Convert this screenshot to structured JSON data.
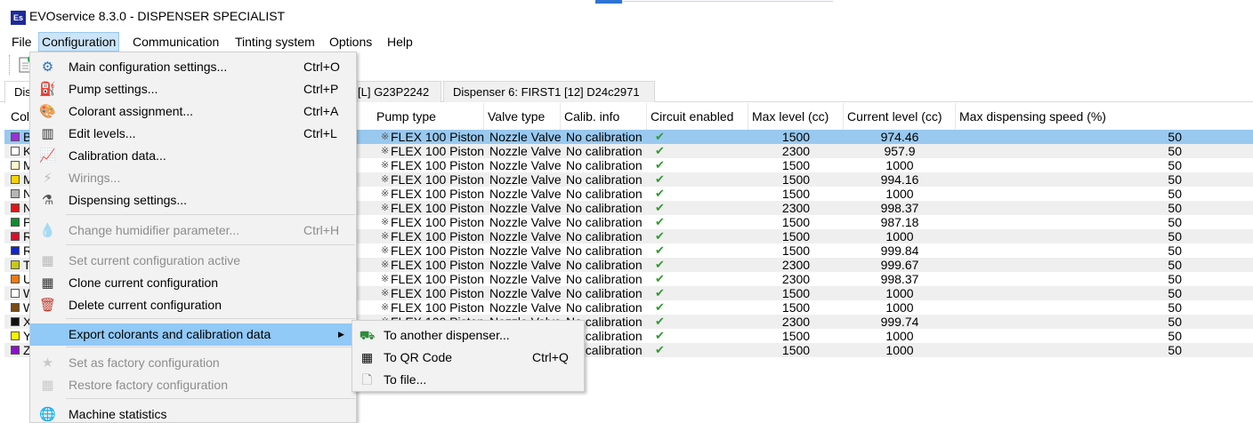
{
  "window": {
    "icon_text": "Es",
    "title": "EVOservice 8.3.0 - DISPENSER SPECIALIST"
  },
  "menubar": [
    "File",
    "Configuration",
    "Communication",
    "Tinting system",
    "Options",
    "Help"
  ],
  "tabs": [
    {
      "label": "Dis"
    },
    {
      "label": "[L] G23P2242"
    },
    {
      "label": "Dispenser 6: FIRST1 [12] D24c2971"
    }
  ],
  "columns": [
    "Colo",
    "Pump type",
    "Valve type",
    "Calib. info",
    "Circuit enabled",
    "Max level (cc)",
    "Current level (cc)",
    "Max dispensing speed (%)"
  ],
  "rows": [
    {
      "color": "#9b30d9",
      "name": "BX",
      "pump": "FLEX 100 Piston",
      "valve": "Nozzle Valve",
      "calib": "No calibration",
      "max": "1500",
      "current": "974.46",
      "speed": "50"
    },
    {
      "color": "#ffffff",
      "name": "KX",
      "pump": "FLEX 100 Piston",
      "valve": "Nozzle Valve",
      "calib": "No calibration",
      "max": "2300",
      "current": "957.9",
      "speed": "50"
    },
    {
      "color": "#fff7cc",
      "name": "MX",
      "pump": "FLEX 100 Piston",
      "valve": "Nozzle Valve",
      "calib": "No calibration",
      "max": "1500",
      "current": "1000",
      "speed": "50"
    },
    {
      "color": "#f5d400",
      "name": "MX",
      "pump": "FLEX 100 Piston",
      "valve": "Nozzle Valve",
      "calib": "No calibration",
      "max": "1500",
      "current": "994.16",
      "speed": "50"
    },
    {
      "color": "#b5b5b5",
      "name": "NX",
      "pump": "FLEX 100 Piston",
      "valve": "Nozzle Valve",
      "calib": "No calibration",
      "max": "1500",
      "current": "1000",
      "speed": "50"
    },
    {
      "color": "#e0151b",
      "name": "NX",
      "pump": "FLEX 100 Piston",
      "valve": "Nozzle Valve",
      "calib": "No calibration",
      "max": "2300",
      "current": "998.37",
      "speed": "50"
    },
    {
      "color": "#118a2e",
      "name": "PX",
      "pump": "FLEX 100 Piston",
      "valve": "Nozzle Valve",
      "calib": "No calibration",
      "max": "1500",
      "current": "987.18",
      "speed": "50"
    },
    {
      "color": "#d8102c",
      "name": "RX",
      "pump": "FLEX 100 Piston",
      "valve": "Nozzle Valve",
      "calib": "No calibration",
      "max": "1500",
      "current": "1000",
      "speed": "50"
    },
    {
      "color": "#1225c9",
      "name": "RX",
      "pump": "FLEX 100 Piston",
      "valve": "Nozzle Valve",
      "calib": "No calibration",
      "max": "1500",
      "current": "999.84",
      "speed": "50"
    },
    {
      "color": "#c8c814",
      "name": "TX",
      "pump": "FLEX 100 Piston",
      "valve": "Nozzle Valve",
      "calib": "No calibration",
      "max": "2300",
      "current": "999.67",
      "speed": "50"
    },
    {
      "color": "#ef7a10",
      "name": "UX",
      "pump": "FLEX 100 Piston",
      "valve": "Nozzle Valve",
      "calib": "No calibration",
      "max": "2300",
      "current": "998.37",
      "speed": "50"
    },
    {
      "color": "#ffffff",
      "name": "WX",
      "pump": "FLEX 100 Piston",
      "valve": "Nozzle Valve",
      "calib": "No calibration",
      "max": "1500",
      "current": "1000",
      "speed": "50"
    },
    {
      "color": "#7a4a14",
      "name": "WX",
      "pump": "FLEX 100 Piston",
      "valve": "Nozzle Valve",
      "calib": "No calibration",
      "max": "1500",
      "current": "1000",
      "speed": "50"
    },
    {
      "color": "#111111",
      "name": "XX",
      "pump": "FLEX 100 Piston",
      "valve": "Nozzle Valve",
      "calib": "No calibration",
      "max": "2300",
      "current": "999.74",
      "speed": "50"
    },
    {
      "color": "#f8f200",
      "name": "YX",
      "pump": "FLEX 100 Piston",
      "valve": "Nozzle Valve",
      "calib": "No calibration",
      "max": "1500",
      "current": "1000",
      "speed": "50"
    },
    {
      "color": "#8a12c9",
      "name": "ZX",
      "pump": "FLEX 100 Piston",
      "valve": "Nozzle Valve",
      "calib": "No calibration",
      "max": "1500",
      "current": "1000",
      "speed": "50"
    }
  ],
  "config_menu": {
    "items": [
      {
        "label": "Main configuration settings...",
        "shortcut": "Ctrl+O",
        "icon": "settings-icon",
        "glyph": "⚙",
        "color": "#2b6fc2",
        "disabled": false
      },
      {
        "label": "Pump settings...",
        "shortcut": "Ctrl+P",
        "icon": "pump-icon",
        "glyph": "⛽",
        "color": "#c0392b",
        "disabled": false
      },
      {
        "label": "Colorant assignment...",
        "shortcut": "Ctrl+A",
        "icon": "palette-icon",
        "glyph": "🎨",
        "color": "#b06a2a",
        "disabled": false
      },
      {
        "label": "Edit levels...",
        "shortcut": "Ctrl+L",
        "icon": "levels-icon",
        "glyph": "▥",
        "color": "#333333",
        "disabled": false
      },
      {
        "label": "Calibration data...",
        "shortcut": "",
        "icon": "chart-icon",
        "glyph": "📈",
        "color": "#2b6fc2",
        "disabled": false
      },
      {
        "label": "Wirings...",
        "shortcut": "",
        "icon": "wiring-icon",
        "glyph": "⚡",
        "color": "#777777",
        "disabled": true
      },
      {
        "label": "Dispensing settings...",
        "shortcut": "",
        "icon": "dispense-icon",
        "glyph": "⚗",
        "color": "#555555",
        "disabled": false
      },
      {
        "label": "Change humidifier parameter...",
        "shortcut": "Ctrl+H",
        "icon": "droplet-icon",
        "glyph": "💧",
        "color": "#777777",
        "disabled": true
      },
      {
        "label": "Set current configuration active",
        "shortcut": "",
        "icon": "building-icon",
        "glyph": "▦",
        "color": "#777777",
        "disabled": true
      },
      {
        "label": "Clone current configuration",
        "shortcut": "",
        "icon": "clone-icon",
        "glyph": "▦",
        "color": "#333333",
        "disabled": false
      },
      {
        "label": "Delete current configuration",
        "shortcut": "",
        "icon": "delete-icon",
        "glyph": "🗑",
        "color": "#c0392b",
        "disabled": false
      },
      {
        "label": "Export colorants and calibration data",
        "shortcut": "",
        "icon": "",
        "glyph": "",
        "color": "#000000",
        "disabled": false
      },
      {
        "label": "Set as factory configuration",
        "shortcut": "",
        "icon": "star-icon",
        "glyph": "★",
        "color": "#999999",
        "disabled": true
      },
      {
        "label": "Restore factory configuration",
        "shortcut": "",
        "icon": "restore-icon",
        "glyph": "▦",
        "color": "#999999",
        "disabled": true
      },
      {
        "label": "Machine statistics",
        "shortcut": "",
        "icon": "globe-icon",
        "glyph": "🌐",
        "color": "#2b6fc2",
        "disabled": false
      }
    ]
  },
  "export_submenu": [
    {
      "label": "To another dispenser...",
      "shortcut": "",
      "icon": "dispenser-icon",
      "glyph": "⛟",
      "color": "#2e8b3a"
    },
    {
      "label": "To QR Code",
      "shortcut": "Ctrl+Q",
      "icon": "qr-code-icon",
      "glyph": "▦",
      "color": "#000000"
    },
    {
      "label": "To file...",
      "shortcut": "",
      "icon": "file-icon",
      "glyph": "🗋",
      "color": "#888888"
    }
  ]
}
